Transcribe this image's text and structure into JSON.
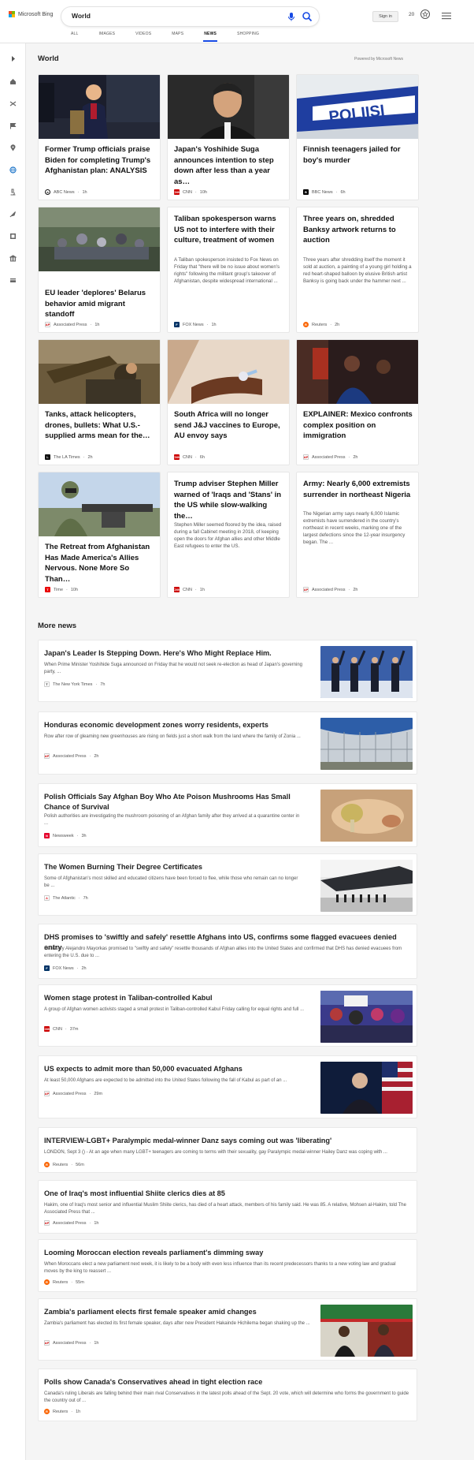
{
  "header": {
    "logo_text": "Microsoft Bing",
    "search_value": "World",
    "signin_label": "Sign in",
    "rewards_count": "20",
    "tabs": [
      {
        "label": "ALL"
      },
      {
        "label": "IMAGES"
      },
      {
        "label": "VIDEOS"
      },
      {
        "label": "MAPS"
      },
      {
        "label": "NEWS",
        "active": true
      },
      {
        "label": "SHOPPING"
      }
    ]
  },
  "colors": {
    "accent": "#174ae4",
    "cnn": "#cc0000",
    "fox": "#003366",
    "reuters": "#fa6400",
    "ap": "#111111"
  },
  "rail": {
    "icons": [
      "expand-icon",
      "home-icon",
      "shuffle-icon",
      "flag-icon",
      "location-icon",
      "globe-icon",
      "microscope-icon",
      "rocket-icon",
      "film-icon",
      "building-icon",
      "card-icon"
    ]
  },
  "world": {
    "title": "World",
    "powered_by": "Powered by Microsoft News",
    "cards": [
      {
        "title": "Former Trump officials praise Biden for completing Trump's Afghanistan plan: ANALYSIS",
        "snippet": "",
        "provider": "ABC News",
        "time": "1h"
      },
      {
        "title": "Japan's Yoshihide Suga announces intention to step down after less than a year as…",
        "snippet": "",
        "provider": "CNN",
        "time": "10h"
      },
      {
        "title": "Finnish teenagers jailed for boy's murder",
        "snippet": "",
        "provider": "BBC News",
        "time": "6h"
      },
      {
        "title": "EU leader 'deplores' Belarus behavior amid migrant standoff",
        "snippet": "",
        "provider": "Associated Press",
        "time": "1h"
      },
      {
        "title": "Taliban spokesperson warns US not to interfere with their culture, treatment of women",
        "snippet": "A Taliban spokesperson insisted to Fox News on Friday that \"there will be no issue about women's rights\" following the militant group's takeover of Afghanistan, despite widespread international ...",
        "provider": "FOX News",
        "time": "1h"
      },
      {
        "title": "Three years on, shredded Banksy artwork returns to auction",
        "snippet": "Three years after shredding itself the moment it sold at auction, a painting of a young girl holding a red heart-shaped balloon by elusive British artist Banksy is going back under the hammer next ...",
        "provider": "Reuters",
        "time": "2h"
      },
      {
        "title": "Tanks, attack helicopters, drones, bullets: What U.S.-supplied arms mean for the…",
        "snippet": "",
        "provider": "The LA Times",
        "time": "2h"
      },
      {
        "title": "South Africa will no longer send J&J vaccines to Europe, AU envoy says",
        "snippet": "",
        "provider": "CNN",
        "time": "6h"
      },
      {
        "title": "EXPLAINER: Mexico confronts complex position on immigration",
        "snippet": "",
        "provider": "Associated Press",
        "time": "2h"
      },
      {
        "title": "The Retreat from Afghanistan Has Made America's Allies Nervous. None More So Than…",
        "snippet": "",
        "provider": "Time",
        "time": "10h"
      },
      {
        "title": "Trump adviser Stephen Miller warned of 'Iraqs and 'Stans' in the US while slow-walking the…",
        "snippet": "Stephen Miller seemed floored by the idea, raised during a fall Cabinet meeting in 2018, of keeping open the doors for Afghan allies and other Middle East refugees to enter the US.",
        "provider": "CNN",
        "time": "1h"
      },
      {
        "title": "Army: Nearly 6,000 extremists surrender in northeast Nigeria",
        "snippet": "The Nigerian army says nearly 6,000 Islamic extremists have surrendered in the country's northeast in recent weeks, marking one of the largest defections since the 12-year insurgency began. The ...",
        "provider": "Associated Press",
        "time": "2h"
      }
    ]
  },
  "more_news": {
    "title": "More news",
    "items": [
      {
        "title": "Japan's Leader Is Stepping Down. Here's Who Might Replace Him.",
        "snippet": "When Prime Minister Yoshihide Suga announced on Friday that he would not seek re-election as head of Japan's governing party, ...",
        "provider": "The New York Times",
        "time": "7h"
      },
      {
        "title": "Honduras economic development zones worry residents, experts",
        "snippet": "Row after row of gleaming new greenhouses are rising on fields just a short walk from the land where the family of Zonia ...",
        "provider": "Associated Press",
        "time": "2h"
      },
      {
        "title": "Polish Officials Say Afghan Boy Who Ate Poison Mushrooms Has Small Chance of Survival",
        "snippet": "Polish authorities are investigating the mushroom poisoning of an Afghan family after they arrived at a quarantine center in ...",
        "provider": "Newsweek",
        "time": "3h"
      },
      {
        "title": "The Women Burning Their Degree Certificates",
        "snippet": "Some of Afghanistan's most skilled and educated citizens have been forced to flee, while those who remain can no longer be ...",
        "provider": "The Atlantic",
        "time": "7h"
      },
      {
        "title": "DHS promises to 'swiftly and safely' resettle Afghans into US, confirms some flagged evacuees denied entry",
        "snippet": "Secretary Alejandro Mayorkas promised to \"swiftly and safely\" resettle thousands of Afghan allies into the United States and confirmed that DHS has denied evacuees from entering the U.S. due to ...",
        "provider": "FOX News",
        "time": "2h"
      },
      {
        "title": "Women stage protest in Taliban-controlled Kabul",
        "snippet": "A group of Afghan women activists staged a small protest in Taliban-controlled Kabul Friday calling for equal rights and full ...",
        "provider": "CNN",
        "time": "37m"
      },
      {
        "title": "US expects to admit more than 50,000 evacuated Afghans",
        "snippet": "At least 50,000 Afghans are expected to be admitted into the United States following the fall of Kabul as part of an ...",
        "provider": "Associated Press",
        "time": "29m"
      },
      {
        "title": "INTERVIEW-LGBT+ Paralympic medal-winner Danz says coming out was 'liberating'",
        "snippet": "LONDON, Sept 3 () - At an age when many LGBT+ teenagers are coming to terms with their sexuality, gay Paralympic medal-winner Hailey Danz was coping with ...",
        "provider": "Reuters",
        "time": "56m"
      },
      {
        "title": "One of Iraq's most influential Shiite clerics dies at 85",
        "snippet": "Hakim, one of Iraq's most senior and influential Muslim Shiite clerics, has died of a heart attack, members of his family said. He was 85. A relative, Mohsen al-Hakim, told The Associated Press that ...",
        "provider": "Associated Press",
        "time": "1h"
      },
      {
        "title": "Looming Moroccan election reveals parliament's dimming sway",
        "snippet": "When Moroccans elect a new parliament next week, it is likely to be a body with even less influence than its recent predecessors thanks to a new voting law and gradual moves by the king to reassert ...",
        "provider": "Reuters",
        "time": "55m"
      },
      {
        "title": "Zambia's parliament elects first female speaker amid changes",
        "snippet": "Zambia's parliament has elected its first female speaker, days after new President Hakainde Hichilema began shaking up the ...",
        "provider": "Associated Press",
        "time": "1h"
      },
      {
        "title": "Polls show Canada's Conservatives ahead in tight election race",
        "snippet": "Canada's ruling Liberals are falling behind their main rival Conservatives in the latest polls ahead of the Sept. 20 vote, which will determine who forms the government to guide the country out of ...",
        "provider": "Reuters",
        "time": "1h"
      }
    ]
  }
}
